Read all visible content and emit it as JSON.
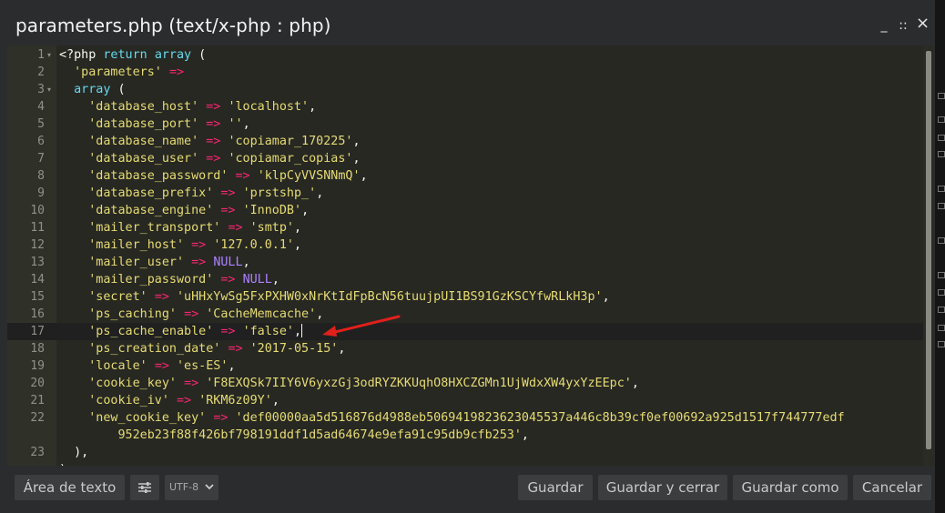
{
  "window": {
    "title": "parameters.php (text/x-php : php)",
    "controls": [
      "_",
      "::",
      "×"
    ]
  },
  "editor": {
    "lines": [
      {
        "num": "1",
        "fold": true,
        "tokens": [
          [
            "p",
            "<?php "
          ],
          [
            "k",
            "return"
          ],
          [
            "p",
            " "
          ],
          [
            "k",
            "array"
          ],
          [
            "p",
            " ("
          ]
        ]
      },
      {
        "num": "2",
        "tokens": [
          [
            "p",
            "  "
          ],
          [
            "s",
            "'parameters'"
          ],
          [
            "p",
            " "
          ],
          [
            "o",
            "=>"
          ]
        ]
      },
      {
        "num": "3",
        "fold": true,
        "tokens": [
          [
            "p",
            "  "
          ],
          [
            "k",
            "array"
          ],
          [
            "p",
            " ("
          ]
        ]
      },
      {
        "num": "4",
        "tokens": [
          [
            "p",
            "    "
          ],
          [
            "s",
            "'database_host'"
          ],
          [
            "p",
            " "
          ],
          [
            "o",
            "=>"
          ],
          [
            "p",
            " "
          ],
          [
            "s",
            "'localhost'"
          ],
          [
            "p",
            ","
          ]
        ]
      },
      {
        "num": "5",
        "tokens": [
          [
            "p",
            "    "
          ],
          [
            "s",
            "'database_port'"
          ],
          [
            "p",
            " "
          ],
          [
            "o",
            "=>"
          ],
          [
            "p",
            " "
          ],
          [
            "s",
            "''"
          ],
          [
            "p",
            ","
          ]
        ]
      },
      {
        "num": "6",
        "tokens": [
          [
            "p",
            "    "
          ],
          [
            "s",
            "'database_name'"
          ],
          [
            "p",
            " "
          ],
          [
            "o",
            "=>"
          ],
          [
            "p",
            " "
          ],
          [
            "s",
            "'copiamar_170225'"
          ],
          [
            "p",
            ","
          ]
        ]
      },
      {
        "num": "7",
        "tokens": [
          [
            "p",
            "    "
          ],
          [
            "s",
            "'database_user'"
          ],
          [
            "p",
            " "
          ],
          [
            "o",
            "=>"
          ],
          [
            "p",
            " "
          ],
          [
            "s",
            "'copiamar_copias'"
          ],
          [
            "p",
            ","
          ]
        ]
      },
      {
        "num": "8",
        "tokens": [
          [
            "p",
            "    "
          ],
          [
            "s",
            "'database_password'"
          ],
          [
            "p",
            " "
          ],
          [
            "o",
            "=>"
          ],
          [
            "p",
            " "
          ],
          [
            "s",
            "'klpCyVVSNNmQ'"
          ],
          [
            "p",
            ","
          ]
        ]
      },
      {
        "num": "9",
        "tokens": [
          [
            "p",
            "    "
          ],
          [
            "s",
            "'database_prefix'"
          ],
          [
            "p",
            " "
          ],
          [
            "o",
            "=>"
          ],
          [
            "p",
            " "
          ],
          [
            "s",
            "'prstshp_'"
          ],
          [
            "p",
            ","
          ]
        ]
      },
      {
        "num": "10",
        "tokens": [
          [
            "p",
            "    "
          ],
          [
            "s",
            "'database_engine'"
          ],
          [
            "p",
            " "
          ],
          [
            "o",
            "=>"
          ],
          [
            "p",
            " "
          ],
          [
            "s",
            "'InnoDB'"
          ],
          [
            "p",
            ","
          ]
        ]
      },
      {
        "num": "11",
        "tokens": [
          [
            "p",
            "    "
          ],
          [
            "s",
            "'mailer_transport'"
          ],
          [
            "p",
            " "
          ],
          [
            "o",
            "=>"
          ],
          [
            "p",
            " "
          ],
          [
            "s",
            "'smtp'"
          ],
          [
            "p",
            ","
          ]
        ]
      },
      {
        "num": "12",
        "tokens": [
          [
            "p",
            "    "
          ],
          [
            "s",
            "'mailer_host'"
          ],
          [
            "p",
            " "
          ],
          [
            "o",
            "=>"
          ],
          [
            "p",
            " "
          ],
          [
            "s",
            "'127.0.0.1'"
          ],
          [
            "p",
            ","
          ]
        ]
      },
      {
        "num": "13",
        "tokens": [
          [
            "p",
            "    "
          ],
          [
            "s",
            "'mailer_user'"
          ],
          [
            "p",
            " "
          ],
          [
            "o",
            "=>"
          ],
          [
            "p",
            " "
          ],
          [
            "c",
            "NULL"
          ],
          [
            "p",
            ","
          ]
        ]
      },
      {
        "num": "14",
        "tokens": [
          [
            "p",
            "    "
          ],
          [
            "s",
            "'mailer_password'"
          ],
          [
            "p",
            " "
          ],
          [
            "o",
            "=>"
          ],
          [
            "p",
            " "
          ],
          [
            "c",
            "NULL"
          ],
          [
            "p",
            ","
          ]
        ]
      },
      {
        "num": "15",
        "tokens": [
          [
            "p",
            "    "
          ],
          [
            "s",
            "'secret'"
          ],
          [
            "p",
            " "
          ],
          [
            "o",
            "=>"
          ],
          [
            "p",
            " "
          ],
          [
            "s",
            "'uHHxYwSg5FxPXHW0xNrKtIdFpBcN56tuujpUI1BS91GzKSCYfwRLkH3p'"
          ],
          [
            "p",
            ","
          ]
        ]
      },
      {
        "num": "16",
        "tokens": [
          [
            "p",
            "    "
          ],
          [
            "s",
            "'ps_caching'"
          ],
          [
            "p",
            " "
          ],
          [
            "o",
            "=>"
          ],
          [
            "p",
            " "
          ],
          [
            "s",
            "'CacheMemcache'"
          ],
          [
            "p",
            ","
          ]
        ]
      },
      {
        "num": "17",
        "active": true,
        "cursor": true,
        "tokens": [
          [
            "p",
            "    "
          ],
          [
            "s",
            "'ps_cache_enable'"
          ],
          [
            "p",
            " "
          ],
          [
            "o",
            "=>"
          ],
          [
            "p",
            " "
          ],
          [
            "s",
            "'false'"
          ],
          [
            "p",
            ","
          ]
        ]
      },
      {
        "num": "18",
        "tokens": [
          [
            "p",
            "    "
          ],
          [
            "s",
            "'ps_creation_date'"
          ],
          [
            "p",
            " "
          ],
          [
            "o",
            "=>"
          ],
          [
            "p",
            " "
          ],
          [
            "s",
            "'2017-05-15'"
          ],
          [
            "p",
            ","
          ]
        ]
      },
      {
        "num": "19",
        "tokens": [
          [
            "p",
            "    "
          ],
          [
            "s",
            "'locale'"
          ],
          [
            "p",
            " "
          ],
          [
            "o",
            "=>"
          ],
          [
            "p",
            " "
          ],
          [
            "s",
            "'es-ES'"
          ],
          [
            "p",
            ","
          ]
        ]
      },
      {
        "num": "20",
        "tokens": [
          [
            "p",
            "    "
          ],
          [
            "s",
            "'cookie_key'"
          ],
          [
            "p",
            " "
          ],
          [
            "o",
            "=>"
          ],
          [
            "p",
            " "
          ],
          [
            "s",
            "'F8EXQSk7IIY6V6yxzGj3odRYZKKUqhO8HXCZGMn1UjWdxXW4yxYzEEpc'"
          ],
          [
            "p",
            ","
          ]
        ]
      },
      {
        "num": "21",
        "tokens": [
          [
            "p",
            "    "
          ],
          [
            "s",
            "'cookie_iv'"
          ],
          [
            "p",
            " "
          ],
          [
            "o",
            "=>"
          ],
          [
            "p",
            " "
          ],
          [
            "s",
            "'RKM6z09Y'"
          ],
          [
            "p",
            ","
          ]
        ]
      },
      {
        "num": "22",
        "tokens": [
          [
            "p",
            "    "
          ],
          [
            "s",
            "'new_cookie_key'"
          ],
          [
            "p",
            " "
          ],
          [
            "o",
            "=>"
          ],
          [
            "p",
            " "
          ],
          [
            "s",
            "'def00000aa5d516876d4988eb5069419823623045537a446c8b39cf0ef00692a925d1517f744777edf"
          ]
        ]
      },
      {
        "num": "",
        "tokens": [
          [
            "s",
            "        952eb23f88f426bf798191ddf1d5ad64674e9efa91c95db9cfb253'"
          ],
          [
            "p",
            ","
          ]
        ]
      },
      {
        "num": "23",
        "tokens": [
          [
            "p",
            "  ),"
          ]
        ]
      },
      {
        "num": "",
        "tokens": [
          [
            "p",
            ");"
          ]
        ]
      }
    ]
  },
  "footer": {
    "text_area_label": "Área de texto",
    "encoding": "UTF-8",
    "save_label": "Guardar",
    "save_close_label": "Guardar y cerrar",
    "save_as_label": "Guardar como",
    "cancel_label": "Cancelar"
  },
  "colors": {
    "editor_bg": "#272822",
    "keyword": "#66d9ef",
    "string": "#e6db74",
    "operator": "#f92672",
    "constant": "#ae81ff",
    "annotation_arrow": "#e0201b"
  }
}
